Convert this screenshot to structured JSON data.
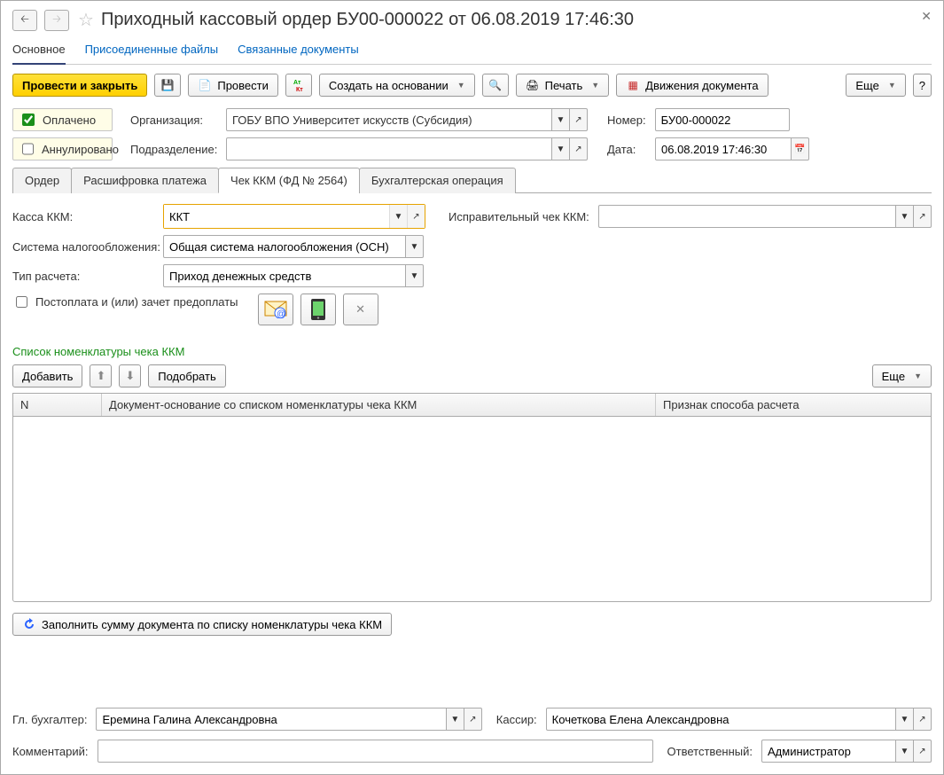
{
  "header": {
    "title": "Приходный кассовый ордер БУ00-000022 от 06.08.2019 17:46:30",
    "sections": {
      "main": "Основное",
      "files": "Присоединенные файлы",
      "linked": "Связанные документы"
    }
  },
  "toolbar": {
    "post_close": "Провести и закрыть",
    "post": "Провести",
    "create_based": "Создать на основании",
    "print": "Печать",
    "movements": "Движения документа",
    "more": "Еще"
  },
  "top_form": {
    "paid_label": "Оплачено",
    "annulled_label": "Аннулировано",
    "org_label": "Организация:",
    "org_value": "ГОБУ ВПО Университет искусств (Субсидия)",
    "number_label": "Номер:",
    "number_value": "БУ00-000022",
    "dept_label": "Подразделение:",
    "dept_value": "",
    "date_label": "Дата:",
    "date_value": "06.08.2019 17:46:30"
  },
  "subtabs": {
    "order": "Ордер",
    "detail": "Расшифровка платежа",
    "kkm": "Чек ККМ (ФД № 2564)",
    "acc": "Бухгалтерская операция"
  },
  "kkm": {
    "kassa_label": "Касса ККМ:",
    "kassa_value": "ККТ",
    "correction_label": "Исправительный чек ККМ:",
    "correction_value": "",
    "tax_label": "Система налогообложения:",
    "tax_value": "Общая система налогообложения (ОСН)",
    "calc_label": "Тип расчета:",
    "calc_value": "Приход денежных средств",
    "postpay_label": "Постоплата и (или) зачет предоплаты"
  },
  "list": {
    "title": "Список номенклатуры чека ККМ",
    "add": "Добавить",
    "pick": "Подобрать",
    "more": "Еще",
    "col_n": "N",
    "col_doc": "Документ-основание со списком номенклатуры чека ККМ",
    "col_sign": "Признак способа расчета",
    "fill_btn": "Заполнить сумму документа по списку номенклатуры чека ККМ"
  },
  "footer": {
    "chief_label": "Гл. бухгалтер:",
    "chief_value": "Еремина Галина Александровна",
    "cashier_label": "Кассир:",
    "cashier_value": "Кочеткова Елена Александровна",
    "comment_label": "Комментарий:",
    "comment_value": "",
    "responsible_label": "Ответственный:",
    "responsible_value": "Администратор"
  }
}
